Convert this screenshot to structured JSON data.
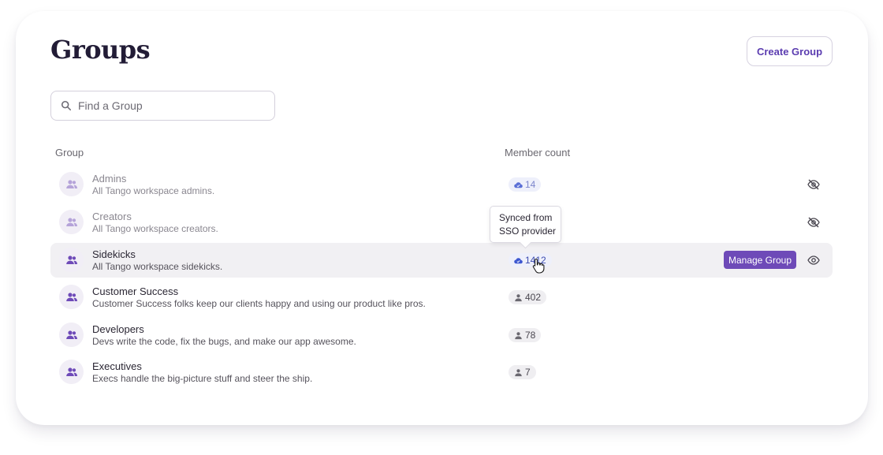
{
  "page": {
    "title": "Groups",
    "create_button": "Create Group"
  },
  "search": {
    "placeholder": "Find a Group",
    "value": ""
  },
  "table": {
    "headers": {
      "group": "Group",
      "member_count": "Member count"
    },
    "rows": [
      {
        "name": "Admins",
        "description": "All Tango workspace admins.",
        "count": "14",
        "count_icon": "cloud-icon",
        "visibility_icon": "eye-slash-icon",
        "state": "hidden"
      },
      {
        "name": "Creators",
        "description": "All Tango workspace creators.",
        "count": "",
        "count_icon": "cloud-icon",
        "visibility_icon": "eye-slash-icon",
        "state": "hidden"
      },
      {
        "name": "Sidekicks",
        "description": "All Tango workspace sidekicks.",
        "count": "1412",
        "count_icon": "cloud-icon",
        "visibility_icon": "eye-icon",
        "state": "hovered",
        "action": "Manage Group"
      },
      {
        "name": "Customer Success",
        "description": "Customer Success folks keep our clients happy and using our product like pros.",
        "count": "402",
        "count_icon": "person-icon"
      },
      {
        "name": "Developers",
        "description": "Devs write the code, fix the bugs, and make our app awesome.",
        "count": "78",
        "count_icon": "person-icon"
      },
      {
        "name": "Executives",
        "description": "Execs handle the big-picture stuff and steer the ship.",
        "count": "7",
        "count_icon": "person-icon"
      }
    ]
  },
  "tooltip": {
    "line1": "Synced from",
    "line2": "SSO provider"
  },
  "colors": {
    "accent": "#6e4ab8",
    "title": "#221c36",
    "sync_badge_text": "#3d4db0",
    "highlight_row": "#f1f0f3"
  }
}
